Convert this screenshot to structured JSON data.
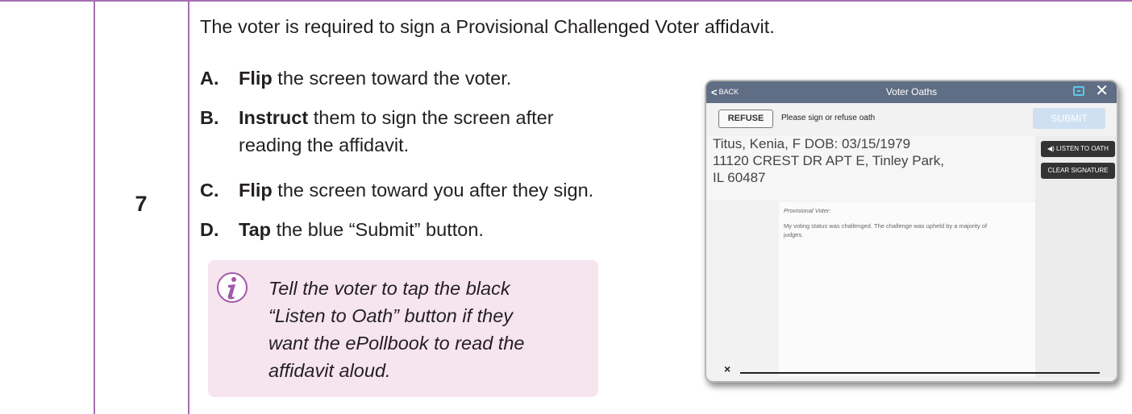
{
  "step_number": "7",
  "intro": "The voter is required to sign a Provisional Challenged Voter affidavit.",
  "steps": [
    {
      "letter": "A.",
      "verb": "Flip",
      "rest": " the screen toward the voter."
    },
    {
      "letter": "B.",
      "verb": "Instruct",
      "rest": " them to sign the screen after",
      "line2": "reading the affidavit."
    },
    {
      "letter": "C.",
      "verb": "Flip",
      "rest": " the screen toward you after they sign."
    },
    {
      "letter": "D.",
      "verb": "Tap",
      "rest": " the blue “Submit” button."
    }
  ],
  "callout": {
    "icon": "info-icon",
    "text": "Tell the voter to tap the black\n“Listen to Oath” button if they\nwant the ePollbook to read the\naffidavit aloud."
  },
  "tablet": {
    "back_label": "BACK",
    "title": "Voter Oaths",
    "refuse_label": "REFUSE",
    "instruction": "Please sign or refuse oath",
    "submit_label": "SUBMIT",
    "voter_line1": "Titus, Kenia, F DOB: 03/15/1979",
    "voter_line2": "11120 CREST DR APT E, Tinley Park,",
    "voter_line3": "IL 60487",
    "listen_label": "◀) LISTEN TO OATH",
    "clear_label": "CLEAR SIGNATURE",
    "affidavit_heading": "Provisional Voter:",
    "affidavit_body": "My voting status was challenged. The challenge was upheld by a majority of judges.",
    "signature_mark": "×",
    "close_glyph": "✕"
  },
  "colors": {
    "rule": "#a66fb0",
    "callout_bg": "#f6e5ef",
    "info_icon": "#a05aa6",
    "tablet_header": "#5f6e85",
    "submit_disabled": "#cfe0f3"
  }
}
